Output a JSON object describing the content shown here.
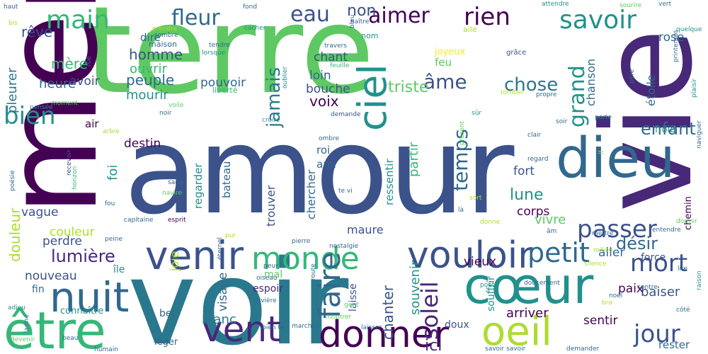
{
  "palette": {
    "c1": "#440154",
    "c2": "#3b528b",
    "c3": "#21918c",
    "c4": "#5ec962",
    "c5": "#35b779",
    "c6": "#2a788e",
    "c7": "#fde725",
    "c8": "#482878",
    "c9": "#addc30",
    "c10": "#31688e"
  },
  "words": [
    {
      "text": "terre",
      "weight": 100,
      "color": "c4"
    },
    {
      "text": "amour",
      "weight": 95,
      "color": "c2"
    },
    {
      "text": "voir",
      "weight": 92,
      "color": "c6"
    },
    {
      "text": "vie",
      "weight": 90,
      "color": "c8"
    },
    {
      "text": "mer",
      "weight": 88,
      "color": "c1"
    },
    {
      "text": "dieu",
      "weight": 55,
      "color": "c10"
    },
    {
      "text": "vouloir",
      "weight": 45,
      "color": "c2"
    },
    {
      "text": "venir",
      "weight": 45,
      "color": "c2"
    },
    {
      "text": "cœur",
      "weight": 45,
      "color": "c3"
    },
    {
      "text": "être",
      "weight": 45,
      "color": "c5"
    },
    {
      "text": "nuit",
      "weight": 44,
      "color": "c10"
    },
    {
      "text": "monde",
      "weight": 40,
      "color": "c5"
    },
    {
      "text": "donner",
      "weight": 40,
      "color": "c1"
    },
    {
      "text": "vent",
      "weight": 40,
      "color": "c8"
    },
    {
      "text": "ciel",
      "weight": 38,
      "color": "c3"
    },
    {
      "text": "oeil",
      "weight": 38,
      "color": "c9"
    },
    {
      "text": "savoir",
      "weight": 34,
      "color": "c3"
    },
    {
      "text": "faire",
      "weight": 34,
      "color": "c10"
    },
    {
      "text": "petit",
      "weight": 32,
      "color": "c10"
    },
    {
      "text": "jour",
      "weight": 30,
      "color": "c2"
    },
    {
      "text": "bien",
      "weight": 30,
      "color": "c3"
    },
    {
      "text": "main",
      "weight": 30,
      "color": "c5"
    },
    {
      "text": "passer",
      "weight": 28,
      "color": "c2"
    },
    {
      "text": "mort",
      "weight": 28,
      "color": "c2"
    },
    {
      "text": "fleur",
      "weight": 26,
      "color": "c10"
    },
    {
      "text": "rien",
      "weight": 26,
      "color": "c1"
    },
    {
      "text": "soleil",
      "weight": 26,
      "color": "c8"
    },
    {
      "text": "eau",
      "weight": 26,
      "color": "c2"
    },
    {
      "text": "aimer",
      "weight": 26,
      "color": "c1"
    },
    {
      "text": "grand",
      "weight": 26,
      "color": "c3"
    },
    {
      "text": "temps",
      "weight": 24,
      "color": "c10"
    },
    {
      "text": "âme",
      "weight": 24,
      "color": "c2"
    },
    {
      "text": "jamais",
      "weight": 24,
      "color": "c6"
    },
    {
      "text": "chose",
      "weight": 22,
      "color": "c6"
    },
    {
      "text": "enfant",
      "weight": 22,
      "color": "c10"
    },
    {
      "text": "lumière",
      "weight": 22,
      "color": "c8"
    },
    {
      "text": "désir",
      "weight": 22,
      "color": "c10"
    },
    {
      "text": "lune",
      "weight": 20,
      "color": "c3"
    },
    {
      "text": "non",
      "weight": 20,
      "color": "c2"
    },
    {
      "text": "triste",
      "weight": 20,
      "color": "c4"
    },
    {
      "text": "voix",
      "weight": 20,
      "color": "c1"
    },
    {
      "text": "chanter",
      "weight": 20,
      "color": "c2"
    },
    {
      "text": "douleur",
      "weight": 20,
      "color": "c9"
    },
    {
      "text": "homme",
      "weight": 18,
      "color": "c2"
    },
    {
      "text": "rêve",
      "weight": 18,
      "color": "c2"
    },
    {
      "text": "mère",
      "weight": 18,
      "color": "c5"
    },
    {
      "text": "peuple",
      "weight": 18,
      "color": "c10"
    },
    {
      "text": "ici",
      "weight": 18,
      "color": "c8"
    },
    {
      "text": "baiser",
      "weight": 18,
      "color": "c2"
    },
    {
      "text": "arriver",
      "weight": 18,
      "color": "c1"
    },
    {
      "text": "souvenir",
      "weight": 17,
      "color": "c3"
    },
    {
      "text": "partir",
      "weight": 17,
      "color": "c5"
    },
    {
      "text": "blanc",
      "weight": 17,
      "color": "c6"
    },
    {
      "text": "vivre",
      "weight": 17,
      "color": "c4"
    },
    {
      "text": "foi",
      "weight": 17,
      "color": "c3"
    },
    {
      "text": "heure",
      "weight": 17,
      "color": "c10"
    },
    {
      "text": "pleurer",
      "weight": 17,
      "color": "c6"
    },
    {
      "text": "mourir",
      "weight": 17,
      "color": "c3"
    },
    {
      "text": "ouvrir",
      "weight": 16,
      "color": "c5"
    },
    {
      "text": "avoir",
      "weight": 16,
      "color": "c2"
    },
    {
      "text": "pouvoir",
      "weight": 16,
      "color": "c10"
    },
    {
      "text": "bouche",
      "weight": 16,
      "color": "c2"
    },
    {
      "text": "loin",
      "weight": 16,
      "color": "c10"
    },
    {
      "text": "chant",
      "weight": 16,
      "color": "c2"
    },
    {
      "text": "rose",
      "weight": 16,
      "color": "c10"
    },
    {
      "text": "étoile",
      "weight": 15,
      "color": "c10"
    },
    {
      "text": "chanson",
      "weight": 15,
      "color": "c10"
    },
    {
      "text": "destin",
      "weight": 16,
      "color": "c1"
    },
    {
      "text": "couleur",
      "weight": 16,
      "color": "c9"
    },
    {
      "text": "vague",
      "weight": 16,
      "color": "c2"
    },
    {
      "text": "perdre",
      "weight": 16,
      "color": "c2"
    },
    {
      "text": "nouveau",
      "weight": 16,
      "color": "c2"
    },
    {
      "text": "joie",
      "weight": 15,
      "color": "c9"
    },
    {
      "text": "visage",
      "weight": 16,
      "color": "c10"
    },
    {
      "text": "corps",
      "weight": 16,
      "color": "c1"
    },
    {
      "text": "fort",
      "weight": 16,
      "color": "c2"
    },
    {
      "text": "aller",
      "weight": 16,
      "color": "c10"
    },
    {
      "text": "paix",
      "weight": 16,
      "color": "c1"
    },
    {
      "text": "sentir",
      "weight": 16,
      "color": "c1"
    },
    {
      "text": "rester",
      "weight": 14,
      "color": "c10"
    },
    {
      "text": "vieux",
      "weight": 16,
      "color": "c1"
    },
    {
      "text": "maure",
      "weight": 15,
      "color": "c2"
    },
    {
      "text": "trouver",
      "weight": 15,
      "color": "c2"
    },
    {
      "text": "chercher",
      "weight": 15,
      "color": "c10"
    },
    {
      "text": "ressentir",
      "weight": 14,
      "color": "c3"
    },
    {
      "text": "regarder",
      "weight": 14,
      "color": "c3"
    },
    {
      "text": "bateau",
      "weight": 14,
      "color": "c10"
    },
    {
      "text": "roi",
      "weight": 14,
      "color": "c10"
    },
    {
      "text": "ami",
      "weight": 14,
      "color": "c10"
    },
    {
      "text": "air",
      "weight": 14,
      "color": "c1"
    },
    {
      "text": "dire",
      "weight": 14,
      "color": "c10"
    },
    {
      "text": "feu",
      "weight": 14,
      "color": "c4"
    },
    {
      "text": "joyeux",
      "weight": 12,
      "color": "c7"
    },
    {
      "text": "force",
      "weight": 13,
      "color": "c2"
    },
    {
      "text": "souffrir",
      "weight": 13,
      "color": "c3"
    },
    {
      "text": "doux",
      "weight": 13,
      "color": "c2"
    },
    {
      "text": "laisse",
      "weight": 13,
      "color": "c2"
    },
    {
      "text": "espoir",
      "weight": 13,
      "color": "c8"
    },
    {
      "text": "mal",
      "weight": 13,
      "color": "c4"
    },
    {
      "text": "île",
      "weight": 13,
      "color": "c3"
    },
    {
      "text": "fin",
      "weight": 13,
      "color": "c10"
    },
    {
      "text": "connaître",
      "weight": 12,
      "color": "c3"
    },
    {
      "text": "bel",
      "weight": 13,
      "color": "c10"
    },
    {
      "text": "léger",
      "weight": 12,
      "color": "c10"
    },
    {
      "text": "froid",
      "weight": 12,
      "color": "c3"
    },
    {
      "text": "chemin",
      "weight": 12,
      "color": "c1"
    },
    {
      "text": "liberté",
      "weight": 10,
      "color": "c5"
    },
    {
      "text": "maison",
      "weight": 10,
      "color": "c10"
    },
    {
      "text": "nom",
      "weight": 10,
      "color": "c3"
    },
    {
      "text": "aile",
      "weight": 10,
      "color": "c9"
    },
    {
      "text": "grâce",
      "weight": 9,
      "color": "c2"
    },
    {
      "text": "sourire",
      "weight": 8,
      "color": "c4"
    },
    {
      "text": "quelque",
      "weight": 8,
      "color": "c3"
    },
    {
      "text": "printemps",
      "weight": 8,
      "color": "c10"
    },
    {
      "text": "plaisir",
      "weight": 8,
      "color": "c3"
    },
    {
      "text": "poésie",
      "weight": 8,
      "color": "c10"
    },
    {
      "text": "pensée",
      "weight": 8,
      "color": "c3"
    },
    {
      "text": "horizon",
      "weight": 8,
      "color": "c5"
    },
    {
      "text": "recevoir",
      "weight": 8,
      "color": "c2"
    },
    {
      "text": "adieu",
      "weight": 8,
      "color": "c3"
    },
    {
      "text": "larme",
      "weight": 8,
      "color": "c10"
    },
    {
      "text": "devenir",
      "weight": 8,
      "color": "c4"
    },
    {
      "text": "beau",
      "weight": 8,
      "color": "c10"
    },
    {
      "text": "humain",
      "weight": 8,
      "color": "c10"
    },
    {
      "text": "haut",
      "weight": 8,
      "color": "c10"
    },
    {
      "text": "bis",
      "weight": 8,
      "color": "c9"
    },
    {
      "text": "naître",
      "weight": 8,
      "color": "c10"
    },
    {
      "text": "cacher",
      "weight": 8,
      "color": "c3"
    },
    {
      "text": "tendre",
      "weight": 8,
      "color": "c10"
    },
    {
      "text": "lorsque",
      "weight": 8,
      "color": "c3"
    },
    {
      "text": "prendre",
      "weight": 8,
      "color": "c9"
    },
    {
      "text": "sombre",
      "weight": 8,
      "color": "c10"
    },
    {
      "text": "fond",
      "weight": 8,
      "color": "c10"
    },
    {
      "text": "travers",
      "weight": 8,
      "color": "c10"
    },
    {
      "text": "feuille",
      "weight": 8,
      "color": "c5"
    },
    {
      "text": "oublier",
      "weight": 8,
      "color": "c3"
    },
    {
      "text": "demande",
      "weight": 8,
      "color": "c2"
    },
    {
      "text": "croire",
      "weight": 8,
      "color": "c3"
    },
    {
      "text": "ombre",
      "weight": 8,
      "color": "c10"
    },
    {
      "text": "te vi",
      "weight": 8,
      "color": "c10"
    },
    {
      "text": "dame",
      "weight": 8,
      "color": "c10"
    },
    {
      "text": "sort",
      "weight": 8,
      "color": "c9"
    },
    {
      "text": "là",
      "weight": 8,
      "color": "c10"
    },
    {
      "text": "donne",
      "weight": 8,
      "color": "c9"
    },
    {
      "text": "âm",
      "weight": 8,
      "color": "c10"
    },
    {
      "text": "attendre",
      "weight": 8,
      "color": "c3"
    },
    {
      "text": "vert",
      "weight": 8,
      "color": "c10"
    },
    {
      "text": "père",
      "weight": 8,
      "color": "c10"
    },
    {
      "text": "propre",
      "weight": 8,
      "color": "c10"
    },
    {
      "text": "tomber",
      "weight": 8,
      "color": "c9"
    },
    {
      "text": "sûr",
      "weight": 8,
      "color": "c3"
    },
    {
      "text": "présent",
      "weight": 8,
      "color": "c4"
    },
    {
      "text": "porte",
      "weight": 8,
      "color": "c3"
    },
    {
      "text": "soir",
      "weight": 8,
      "color": "c10"
    },
    {
      "text": "clair",
      "weight": 8,
      "color": "c10"
    },
    {
      "text": "regard",
      "weight": 8,
      "color": "c10"
    },
    {
      "text": "naviguer",
      "weight": 8,
      "color": "c10"
    },
    {
      "text": "sang",
      "weight": 8,
      "color": "c10"
    },
    {
      "text": "navire",
      "weight": 8,
      "color": "c4"
    },
    {
      "text": "fou",
      "weight": 8,
      "color": "c10"
    },
    {
      "text": "capitaine",
      "weight": 8,
      "color": "c10"
    },
    {
      "text": "esprit",
      "weight": 8,
      "color": "c1"
    },
    {
      "text": "peine",
      "weight": 8,
      "color": "c10"
    },
    {
      "text": "pierre",
      "weight": 8,
      "color": "c10"
    },
    {
      "text": "nostalgie",
      "weight": 8,
      "color": "c10"
    },
    {
      "text": "éternel",
      "weight": 8,
      "color": "c10"
    },
    {
      "text": "pur",
      "weight": 8,
      "color": "c9"
    },
    {
      "text": "route",
      "weight": 8,
      "color": "c10"
    },
    {
      "text": "peur",
      "weight": 8,
      "color": "c10"
    },
    {
      "text": "oiseau",
      "weight": 8,
      "color": "c10"
    },
    {
      "text": "rivière",
      "weight": 8,
      "color": "c10"
    },
    {
      "text": "poète",
      "weight": 8,
      "color": "c3"
    },
    {
      "text": "doucement",
      "weight": 8,
      "color": "c10"
    },
    {
      "text": "milieu",
      "weight": 8,
      "color": "c9"
    },
    {
      "text": "silence",
      "weight": 8,
      "color": "c9"
    },
    {
      "text": "mettre",
      "weight": 8,
      "color": "c10"
    },
    {
      "text": "entendre",
      "weight": 8,
      "color": "c10"
    },
    {
      "text": "dormir",
      "weight": 8,
      "color": "c4"
    },
    {
      "text": "lire",
      "weight": 8,
      "color": "c10"
    },
    {
      "text": "noël",
      "weight": 8,
      "color": "c10"
    },
    {
      "text": "bra",
      "weight": 8,
      "color": "c9"
    },
    {
      "text": "contre",
      "weight": 8,
      "color": "c10"
    },
    {
      "text": "côté",
      "weight": 8,
      "color": "c10"
    },
    {
      "text": "raison",
      "weight": 8,
      "color": "c3"
    },
    {
      "text": "montrer",
      "weight": 8,
      "color": "c4"
    },
    {
      "text": "marcher",
      "weight": 8,
      "color": "c10"
    },
    {
      "text": "laisser",
      "weight": 8,
      "color": "c10"
    },
    {
      "text": "bien te",
      "weight": 8,
      "color": "c10"
    },
    {
      "text": "gent",
      "weight": 8,
      "color": "c4"
    },
    {
      "text": "savoir savoir",
      "weight": 8,
      "color": "c10"
    },
    {
      "text": "demander",
      "weight": 8,
      "color": "c10"
    },
    {
      "text": "moment",
      "weight": 8,
      "color": "c4"
    },
    {
      "text": "noir",
      "weight": 8,
      "color": "c10"
    },
    {
      "text": "voile",
      "weight": 8,
      "color": "c4"
    },
    {
      "text": "arbre",
      "weight": 8,
      "color": "c9"
    },
    {
      "text": "il",
      "weight": 8,
      "color": "c9"
    },
    {
      "text": "rue",
      "weight": 8,
      "color": "c10"
    },
    {
      "text": "bleu",
      "weight": 8,
      "color": "c10"
    }
  ]
}
